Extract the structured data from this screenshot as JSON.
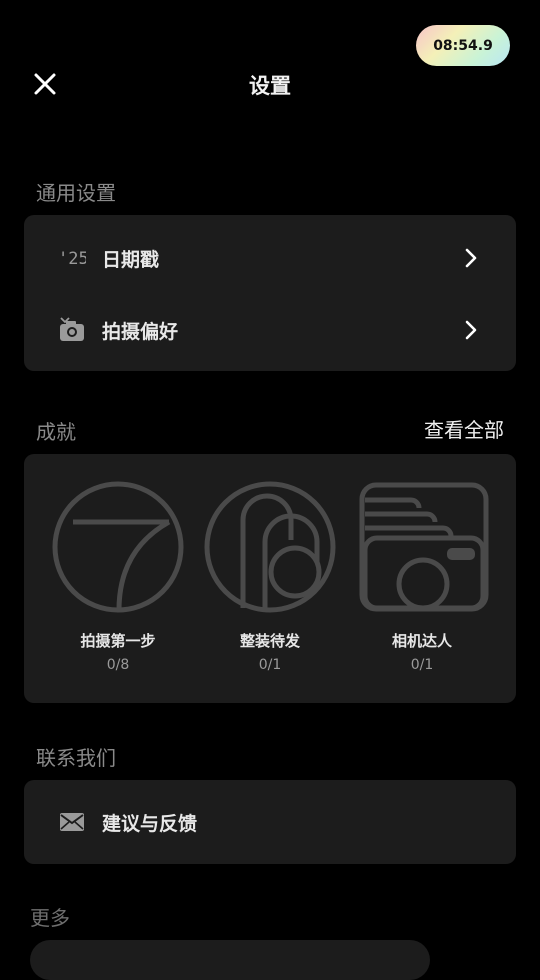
{
  "header": {
    "timer": "08:54.9",
    "title": "设置"
  },
  "general": {
    "label": "通用设置",
    "items": [
      {
        "label": "日期戳",
        "icon": "date-stamp-icon"
      },
      {
        "label": "拍摄偏好",
        "icon": "camera-preference-icon"
      }
    ]
  },
  "achievements": {
    "label": "成就",
    "view_all": "查看全部",
    "items": [
      {
        "name": "拍摄第一步",
        "progress": "0/8",
        "icon": "first-step-badge-icon"
      },
      {
        "name": "整装待发",
        "progress": "0/1",
        "icon": "ready-to-go-badge-icon"
      },
      {
        "name": "相机达人",
        "progress": "0/1",
        "icon": "camera-expert-badge-icon"
      }
    ]
  },
  "contact": {
    "label": "联系我们",
    "items": [
      {
        "label": "建议与反馈",
        "icon": "mail-icon"
      }
    ]
  },
  "more": {
    "label": "更多"
  },
  "colors": {
    "background": "#000000",
    "card": "#1c1c1c",
    "section_label": "#8a8a8a",
    "badge_stroke": "#4a4a4a"
  }
}
